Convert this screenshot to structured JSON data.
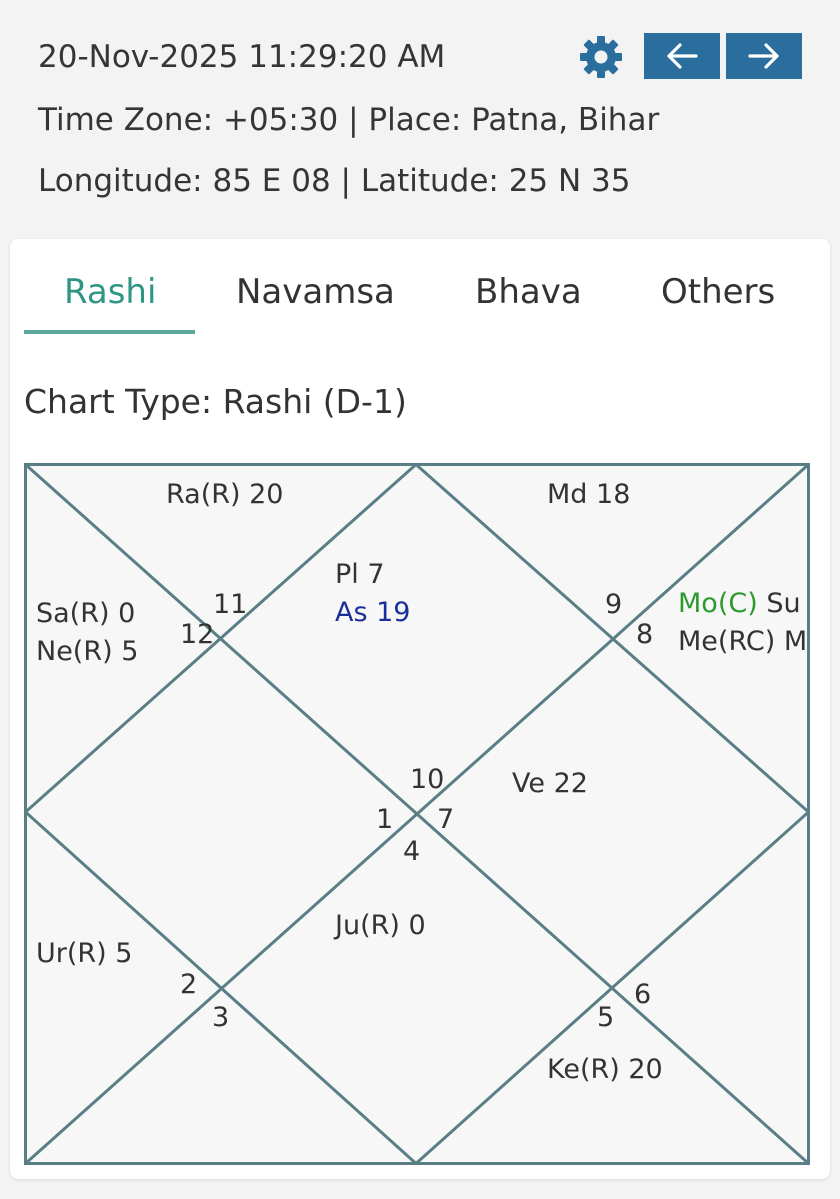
{
  "header": {
    "datetime": "20-Nov-2025 11:29:20 AM",
    "timezone_place": "Time Zone: +05:30 | Place: Patna, Bihar",
    "long_lat": "Longitude: 85 E 08 | Latitude: 25 N 35",
    "settings_icon": "gear-icon",
    "prev_icon": "arrow-left-icon",
    "next_icon": "arrow-right-icon"
  },
  "colors": {
    "nav_button": "#2a6e9e",
    "active_tab": "#2f9584",
    "chart_lines": "#5a7e85",
    "ascendant": "#1a2f9b",
    "moon": "#2c9a2c"
  },
  "tabs": [
    {
      "label": "Rashi",
      "active": true
    },
    {
      "label": "Navamsa",
      "active": false
    },
    {
      "label": "Bhava",
      "active": false
    },
    {
      "label": "Others",
      "active": false
    }
  ],
  "chart": {
    "type_label": "Chart Type: Rashi (D-1)",
    "house_numbers": [
      "11",
      "12",
      "9",
      "8",
      "10",
      "1",
      "7",
      "4",
      "2",
      "3",
      "5",
      "6"
    ],
    "planets": {
      "top_left": "Ra(R) 20",
      "top_right": "Md 18",
      "top_center_1": "Pl 7",
      "top_center_2": "As 19",
      "left_1": "Sa(R) 0",
      "left_2": "Ne(R) 5",
      "right_1a": "Mo(C)",
      "right_1b": "Su",
      "right_2": "Me(RC) M",
      "right_mid": "Ve 22",
      "bottom_center": "Ju(R) 0",
      "bottom_left": "Ur(R) 5",
      "bottom_right": "Ke(R) 20"
    }
  }
}
